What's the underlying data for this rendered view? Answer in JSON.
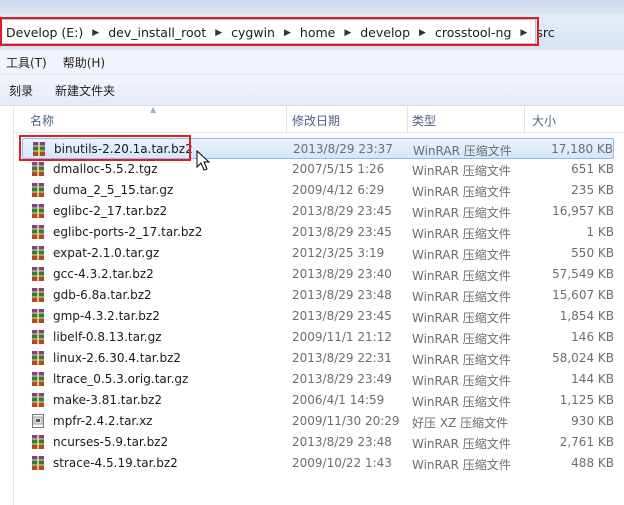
{
  "address": {
    "crumbs": [
      "Develop (E:)",
      "dev_install_root",
      "cygwin",
      "home",
      "develop",
      "crosstool-ng",
      "src"
    ]
  },
  "menu": {
    "tools": "工具(T)",
    "help": "帮助(H)"
  },
  "toolbar": {
    "burn": "刻录",
    "new_folder": "新建文件夹"
  },
  "columns": {
    "name": "名称",
    "modified": "修改日期",
    "type": "类型",
    "size": "大小"
  },
  "files": [
    {
      "name": "binutils-2.20.1a.tar.bz2",
      "date": "2013/8/29 23:37",
      "type": "WinRAR 压缩文件",
      "size": "17,180 KB",
      "icon": "winrar-archive-icon",
      "selected": true
    },
    {
      "name": "dmalloc-5.5.2.tgz",
      "date": "2007/5/15 1:26",
      "type": "WinRAR 压缩文件",
      "size": "651 KB",
      "icon": "winrar-archive-icon"
    },
    {
      "name": "duma_2_5_15.tar.gz",
      "date": "2009/4/12 6:29",
      "type": "WinRAR 压缩文件",
      "size": "235 KB",
      "icon": "winrar-archive-icon"
    },
    {
      "name": "eglibc-2_17.tar.bz2",
      "date": "2013/8/29 23:45",
      "type": "WinRAR 压缩文件",
      "size": "16,957 KB",
      "icon": "winrar-archive-icon"
    },
    {
      "name": "eglibc-ports-2_17.tar.bz2",
      "date": "2013/8/29 23:45",
      "type": "WinRAR 压缩文件",
      "size": "1 KB",
      "icon": "winrar-archive-icon"
    },
    {
      "name": "expat-2.1.0.tar.gz",
      "date": "2012/3/25 3:19",
      "type": "WinRAR 压缩文件",
      "size": "550 KB",
      "icon": "winrar-archive-icon"
    },
    {
      "name": "gcc-4.3.2.tar.bz2",
      "date": "2013/8/29 23:40",
      "type": "WinRAR 压缩文件",
      "size": "57,549 KB",
      "icon": "winrar-archive-icon"
    },
    {
      "name": "gdb-6.8a.tar.bz2",
      "date": "2013/8/29 23:48",
      "type": "WinRAR 压缩文件",
      "size": "15,607 KB",
      "icon": "winrar-archive-icon"
    },
    {
      "name": "gmp-4.3.2.tar.bz2",
      "date": "2013/8/29 23:45",
      "type": "WinRAR 压缩文件",
      "size": "1,854 KB",
      "icon": "winrar-archive-icon"
    },
    {
      "name": "libelf-0.8.13.tar.gz",
      "date": "2009/11/1 21:12",
      "type": "WinRAR 压缩文件",
      "size": "146 KB",
      "icon": "winrar-archive-icon"
    },
    {
      "name": "linux-2.6.30.4.tar.bz2",
      "date": "2013/8/29 22:31",
      "type": "WinRAR 压缩文件",
      "size": "58,024 KB",
      "icon": "winrar-archive-icon"
    },
    {
      "name": "ltrace_0.5.3.orig.tar.gz",
      "date": "2013/8/29 23:49",
      "type": "WinRAR 压缩文件",
      "size": "144 KB",
      "icon": "winrar-archive-icon"
    },
    {
      "name": "make-3.81.tar.bz2",
      "date": "2006/4/1 14:59",
      "type": "WinRAR 压缩文件",
      "size": "1,125 KB",
      "icon": "winrar-archive-icon"
    },
    {
      "name": "mpfr-2.4.2.tar.xz",
      "date": "2009/11/30 20:29",
      "type": "好压 XZ 压缩文件",
      "size": "930 KB",
      "icon": "xz-archive-icon"
    },
    {
      "name": "ncurses-5.9.tar.bz2",
      "date": "2013/8/29 23:48",
      "type": "WinRAR 压缩文件",
      "size": "2,761 KB",
      "icon": "winrar-archive-icon"
    },
    {
      "name": "strace-4.5.19.tar.bz2",
      "date": "2009/10/22 1:43",
      "type": "WinRAR 压缩文件",
      "size": "488 KB",
      "icon": "winrar-archive-icon"
    }
  ]
}
